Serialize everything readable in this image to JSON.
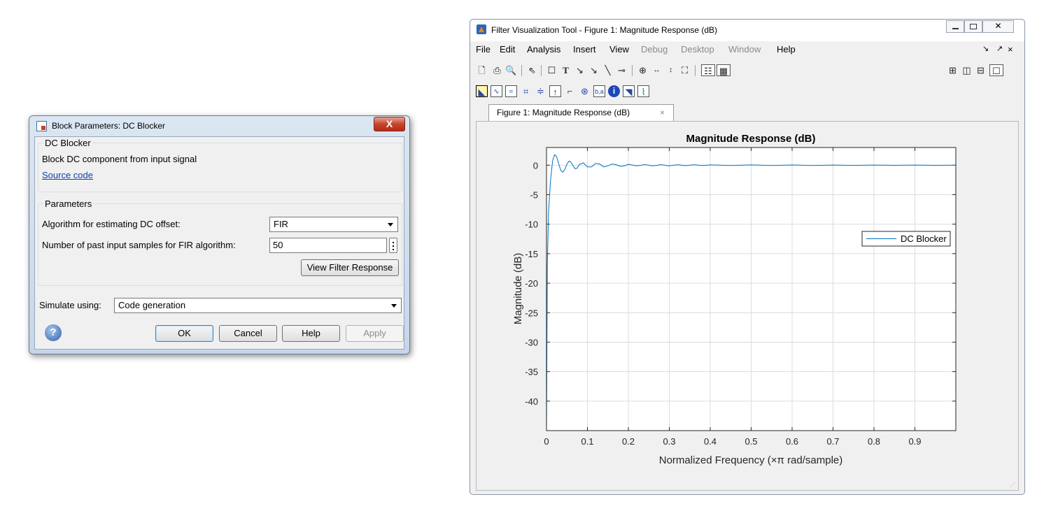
{
  "dialog": {
    "title": "Block Parameters: DC Blocker",
    "close_label": "X",
    "block_group": {
      "legend": "DC Blocker",
      "description": "Block DC component from input signal",
      "source_link": "Source code"
    },
    "parameters_group": {
      "legend": "Parameters",
      "algorithm_label": "Algorithm for estimating DC offset:",
      "algorithm_value": "FIR",
      "samples_label": "Number of past input samples for FIR algorithm:",
      "samples_value": "50",
      "view_button": "View Filter Response"
    },
    "simulate_label": "Simulate using:",
    "simulate_value": "Code generation",
    "buttons": {
      "ok": "OK",
      "cancel": "Cancel",
      "help": "Help",
      "apply": "Apply"
    },
    "help_icon": "question-icon"
  },
  "fvtool": {
    "title": "Filter Visualization Tool - Figure 1: Magnitude Response (dB)",
    "menu": [
      "File",
      "Edit",
      "Analysis",
      "Insert",
      "View",
      "Debug",
      "Desktop",
      "Window",
      "Help"
    ],
    "menu_disabled": [
      "Debug",
      "Desktop",
      "Window"
    ],
    "menu_right": [
      "↘",
      "↗",
      "×"
    ],
    "tab_label": "Figure 1: Magnitude Response (dB)",
    "tab_close": "×"
  },
  "chart_data": {
    "type": "line",
    "title": "Magnitude Response (dB)",
    "xlabel": "Normalized Frequency (×π rad/sample)",
    "ylabel": "Magnitude (dB)",
    "xlim": [
      0,
      1
    ],
    "ylim": [
      -45,
      3
    ],
    "xticks": [
      0,
      0.1,
      0.2,
      0.3,
      0.4,
      0.5,
      0.6,
      0.7,
      0.8,
      0.9
    ],
    "yticks": [
      0,
      -5,
      -10,
      -15,
      -20,
      -25,
      -30,
      -35,
      -40
    ],
    "grid": true,
    "legend_position": "right",
    "series": [
      {
        "name": "DC Blocker",
        "color": "#0072bd",
        "x": [
          0,
          0.002,
          0.005,
          0.01,
          0.015,
          0.02,
          0.025,
          0.03,
          0.035,
          0.04,
          0.045,
          0.05,
          0.055,
          0.06,
          0.065,
          0.07,
          0.075,
          0.08,
          0.09,
          0.1,
          0.11,
          0.12,
          0.13,
          0.14,
          0.15,
          0.16,
          0.17,
          0.18,
          0.19,
          0.2,
          0.22,
          0.24,
          0.26,
          0.28,
          0.3,
          0.32,
          0.34,
          0.36,
          0.38,
          0.4,
          0.45,
          0.5,
          0.55,
          0.6,
          0.65,
          0.7,
          0.75,
          0.8,
          0.85,
          0.9,
          0.95,
          1.0
        ],
        "y": [
          -45,
          -17,
          -8,
          -2.5,
          0.8,
          1.8,
          1.4,
          0.2,
          -0.9,
          -1.2,
          -0.7,
          0.2,
          0.7,
          0.5,
          -0.1,
          -0.6,
          -0.5,
          0.1,
          0.4,
          -0.3,
          -0.3,
          0.3,
          0.2,
          -0.3,
          -0.1,
          0.2,
          0.1,
          -0.2,
          -0.1,
          0.15,
          -0.1,
          0.1,
          -0.1,
          0.1,
          -0.1,
          0.08,
          -0.08,
          0.08,
          -0.06,
          0.05,
          -0.05,
          0.05,
          -0.04,
          0.04,
          -0.04,
          0.03,
          -0.03,
          0.03,
          -0.02,
          0.02,
          -0.02,
          0
        ]
      }
    ]
  }
}
